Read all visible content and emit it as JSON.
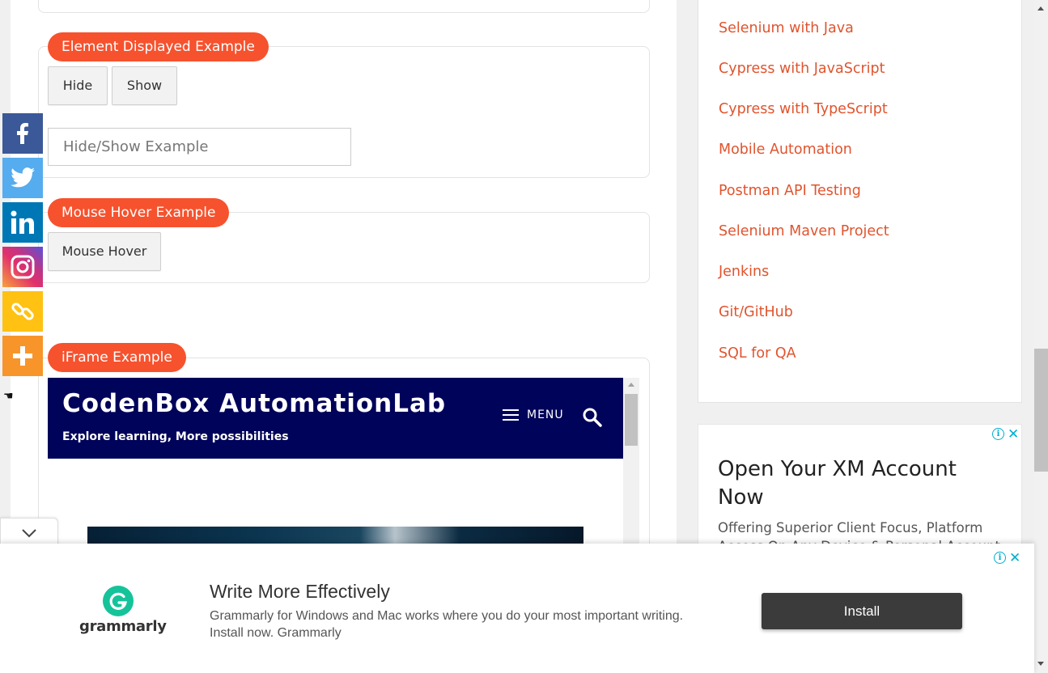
{
  "element_displayed": {
    "legend": "Element Displayed Example",
    "hide_button": "Hide",
    "show_button": "Show",
    "input_placeholder": "Hide/Show Example"
  },
  "mouse_hover": {
    "legend": "Mouse Hover Example",
    "button": "Mouse Hover"
  },
  "iframe_section": {
    "legend": "iFrame Example",
    "site_title": "CodenBox AutomationLab",
    "tagline": "Explore learning, More possibilities",
    "menu_label": "MENU"
  },
  "sidebar": {
    "links": [
      "Selenium with Java",
      "Cypress with JavaScript",
      "Cypress with TypeScript",
      "Mobile Automation",
      "Postman API Testing",
      "Selenium Maven Project",
      "Jenkins",
      "Git/GitHub",
      "SQL for QA"
    ]
  },
  "side_ad": {
    "title": "Open Your XM Account Now",
    "subtitle": "Offering Superior Client Focus, Platform Access On Any Device & Personal Account"
  },
  "bottom_ad": {
    "brand": "grammarly",
    "title": "Write More Effectively",
    "description": "Grammarly for Windows and Mac works where you do your most important writing. Install now. Grammarly",
    "install_button": "Install"
  },
  "social": [
    "facebook-icon",
    "twitter-icon",
    "linkedin-icon",
    "instagram-icon",
    "copy-link-icon",
    "more-icon"
  ],
  "colors": {
    "accent": "#f6522e",
    "link": "#e0542e",
    "iframe_header": "#00035a",
    "ad_close": "#00aecd"
  }
}
